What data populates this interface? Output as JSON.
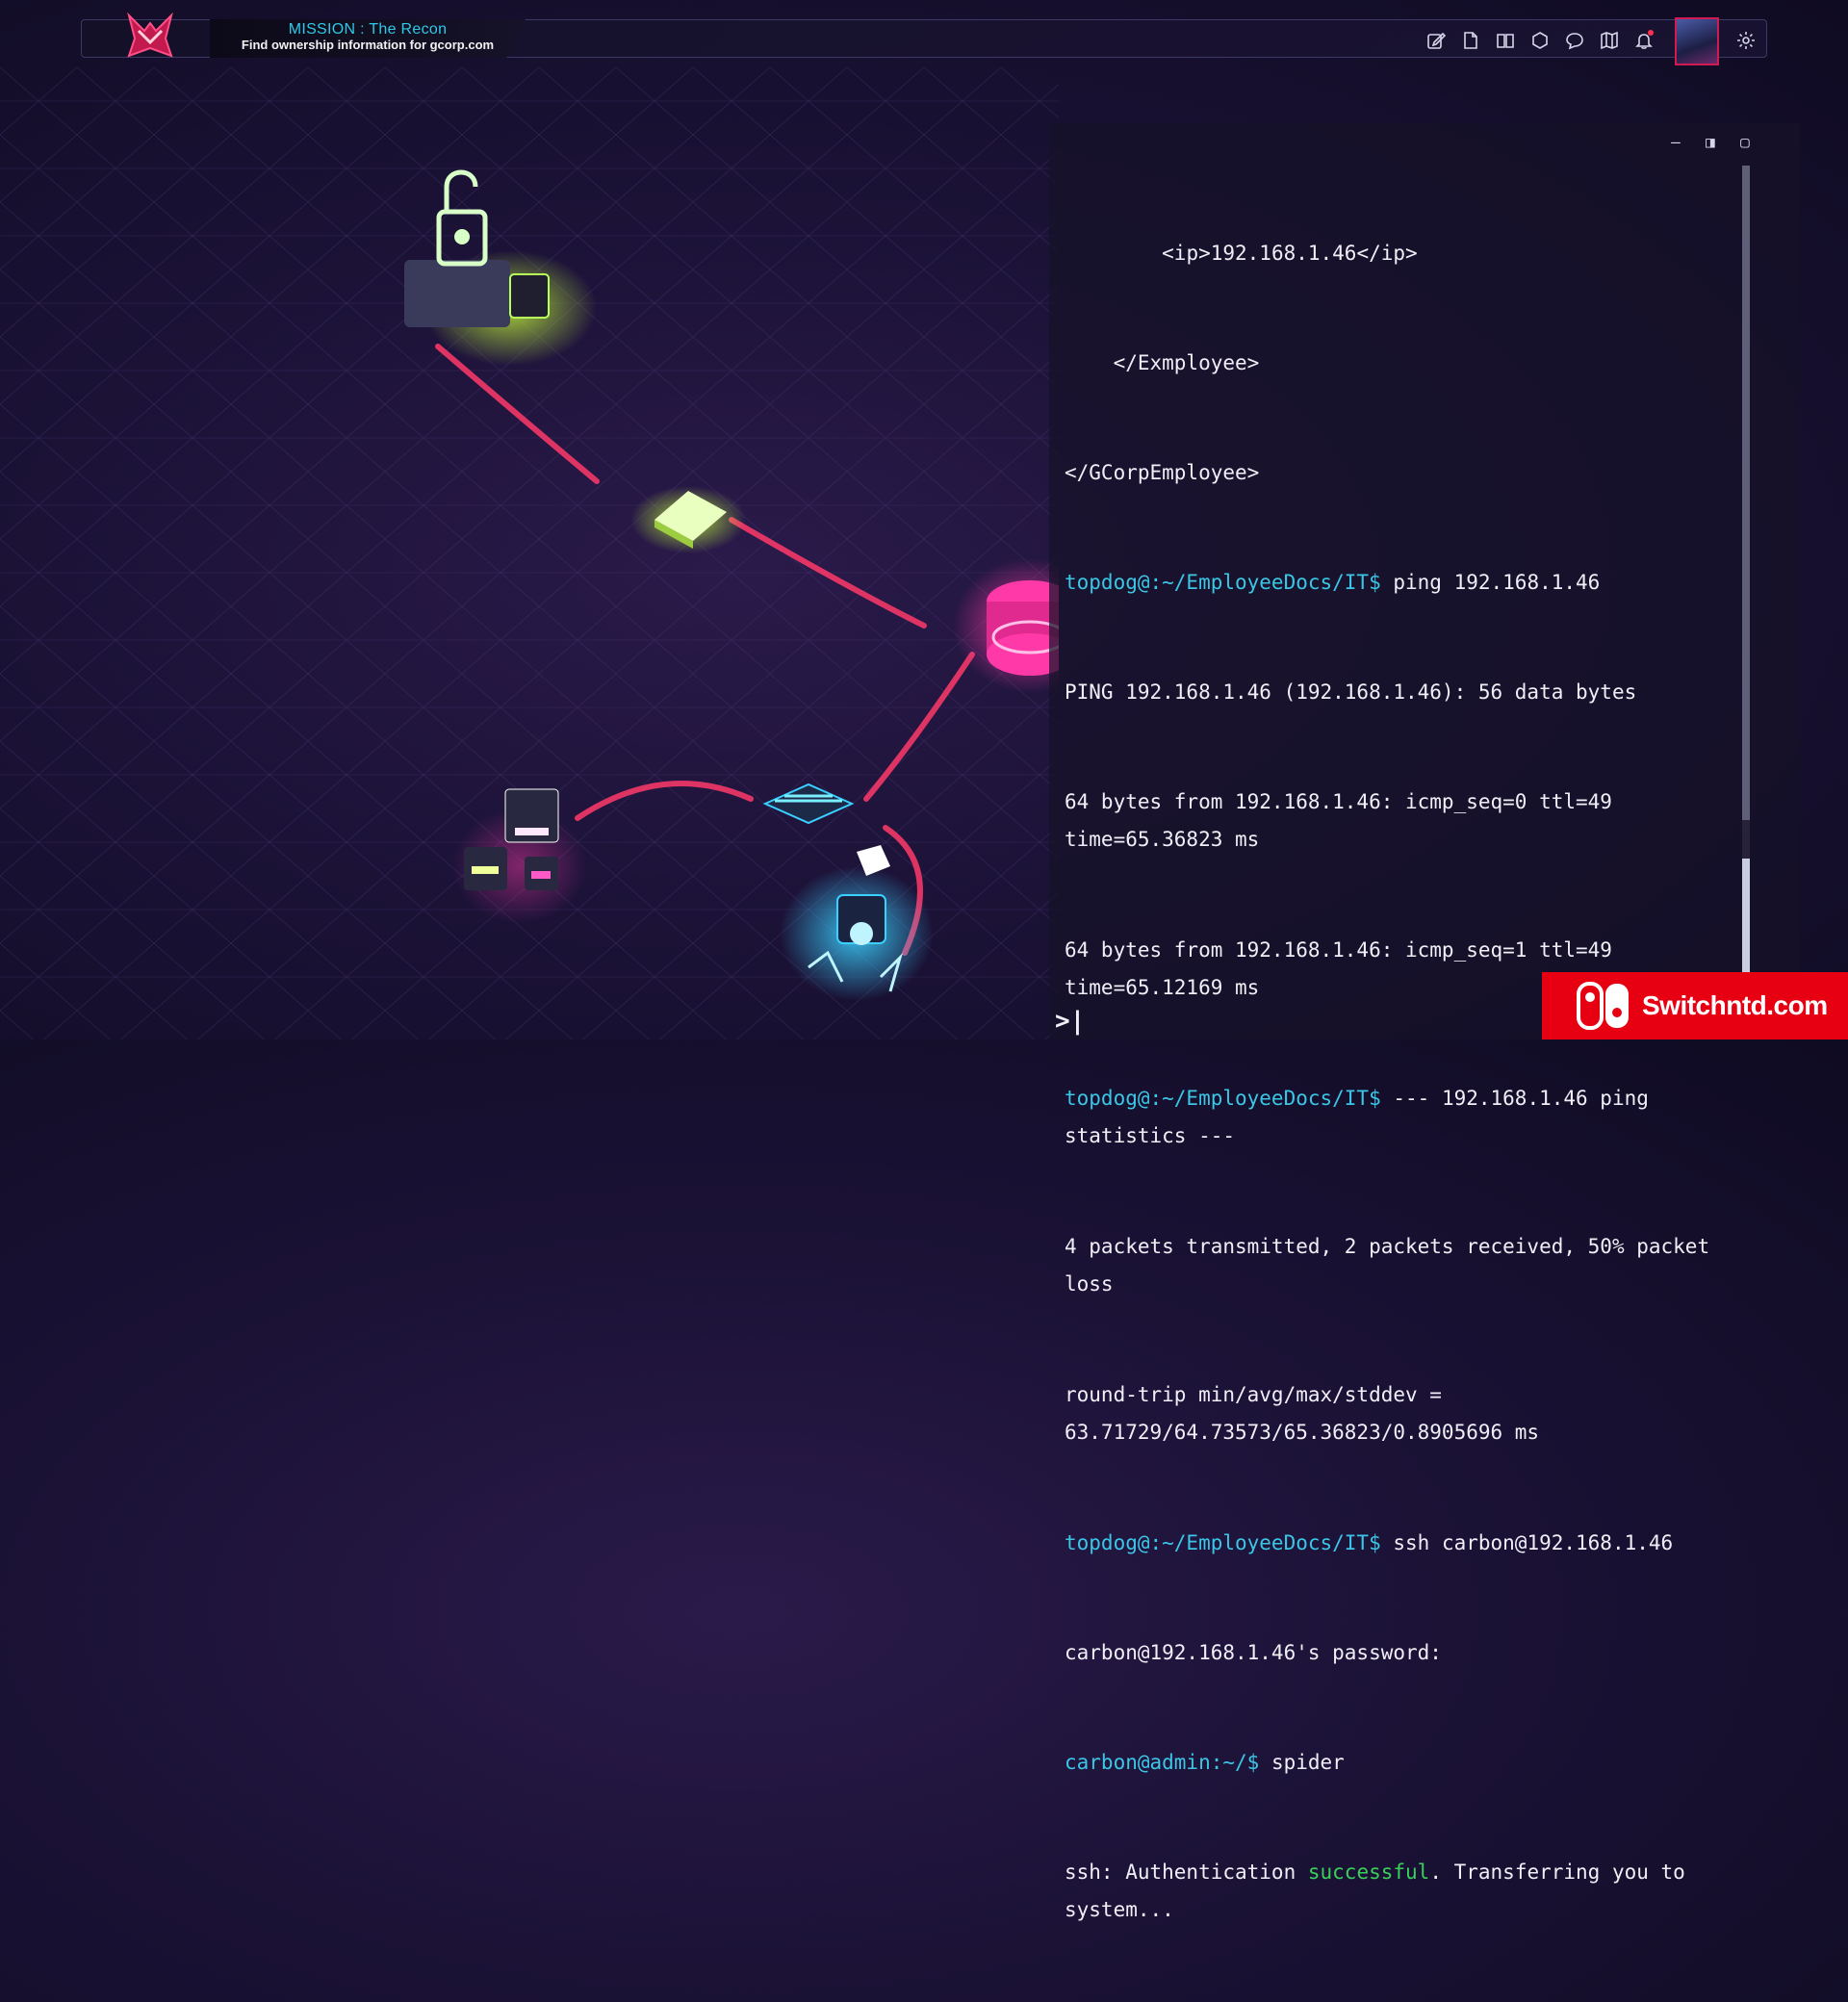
{
  "mission": {
    "title": "MISSION : The Recon",
    "subtitle": "Find ownership information for gcorp.com"
  },
  "toolbar": {
    "icons": [
      "edit-icon",
      "document-icon",
      "book-icon",
      "hexagon-icon",
      "chat-icon",
      "map-icon",
      "bell-icon"
    ],
    "avatar": "avatar",
    "settings": "gear-icon"
  },
  "terminal": {
    "controls": [
      "minimize",
      "split",
      "maximize"
    ],
    "lines": {
      "l1": "        <ip>192.168.1.46</ip>",
      "l2": "    </Exmployee>",
      "l3": "</GCorpEmployee>",
      "l4_prompt": "topdog@:~/EmployeeDocs/IT$",
      "l4_cmd": " ping 192.168.1.46",
      "l5": "PING 192.168.1.46 (192.168.1.46): 56 data bytes",
      "l6": "64 bytes from 192.168.1.46: icmp_seq=0 ttl=49\ntime=65.36823 ms",
      "l7": "64 bytes from 192.168.1.46: icmp_seq=1 ttl=49\ntime=65.12169 ms",
      "l8_prompt": "topdog@:~/EmployeeDocs/IT$",
      "l8_cmd": " --- 192.168.1.46 ping\nstatistics ---",
      "l9": "4 packets transmitted, 2 packets received, 50% packet\nloss",
      "l10": "round-trip min/avg/max/stddev =\n63.71729/64.73573/65.36823/0.8905696 ms",
      "l11_prompt": "topdog@:~/EmployeeDocs/IT$",
      "l11_cmd": " ssh carbon@192.168.1.46",
      "l12": "carbon@192.168.1.46's password:",
      "l13_prompt": "carbon@admin:~/$",
      "l13_cmd": " spider",
      "l14_pre": "ssh: Authentication ",
      "l14_ok": "successful",
      "l14_post": ". Transferring you to\nsystem..."
    },
    "cursor": ">|"
  },
  "colors": {
    "prompt": "#3cc6e6",
    "success": "#3ad05a",
    "link": "#ff3a6a",
    "accent": "#d01a52"
  },
  "watermark": {
    "text": "Switchntd.com"
  }
}
